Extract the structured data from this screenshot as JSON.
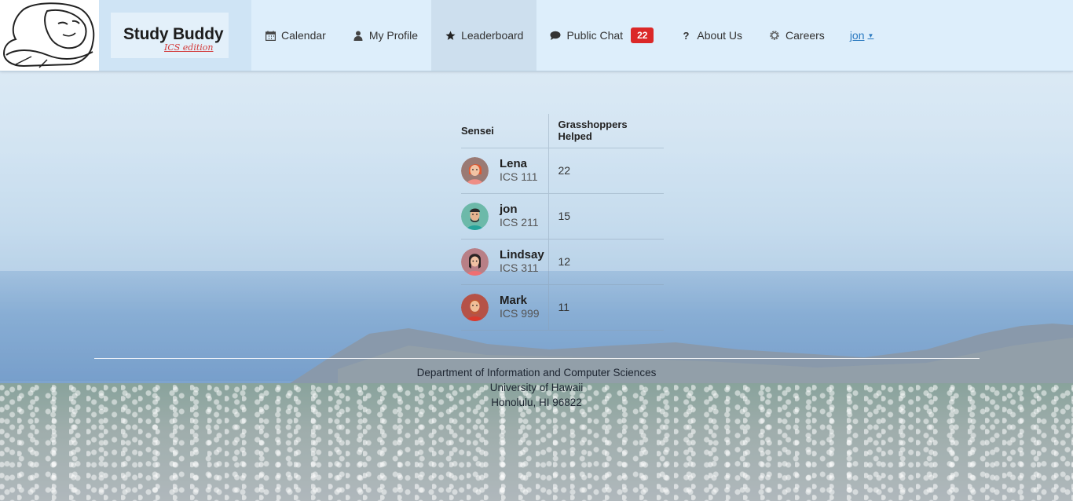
{
  "brand": {
    "title": "Study Buddy",
    "subtitle": "ICS edition"
  },
  "nav": {
    "items": [
      {
        "label": "Calendar",
        "icon": "calendar-icon"
      },
      {
        "label": "My Profile",
        "icon": "user-icon"
      },
      {
        "label": "Leaderboard",
        "icon": "star-icon",
        "active": true
      },
      {
        "label": "Public Chat",
        "icon": "chat-icon",
        "badge": "22"
      },
      {
        "label": "About Us",
        "icon": "question-icon"
      },
      {
        "label": "Careers",
        "icon": "gear-icon"
      }
    ],
    "user": "jon",
    "badge_color": "#db2828"
  },
  "leaderboard": {
    "headers": {
      "sensei": "Sensei",
      "helped": "Grasshoppers Helped"
    },
    "rows": [
      {
        "name": "Lena",
        "course": "ICS 111",
        "helped": "22",
        "avatar_bg": "#c0706b"
      },
      {
        "name": "jon",
        "course": "ICS 211",
        "helped": "15",
        "avatar_bg": "#6cb9a9"
      },
      {
        "name": "Lindsay",
        "course": "ICS 311",
        "helped": "12",
        "avatar_bg": "#b87f86"
      },
      {
        "name": "Mark",
        "course": "ICS 999",
        "helped": "11",
        "avatar_bg": "#b55248"
      }
    ]
  },
  "footer": {
    "line1": "Department of Information and Computer Sciences",
    "line2": "University of Hawaii",
    "line3": "Honolulu, HI 96822"
  }
}
